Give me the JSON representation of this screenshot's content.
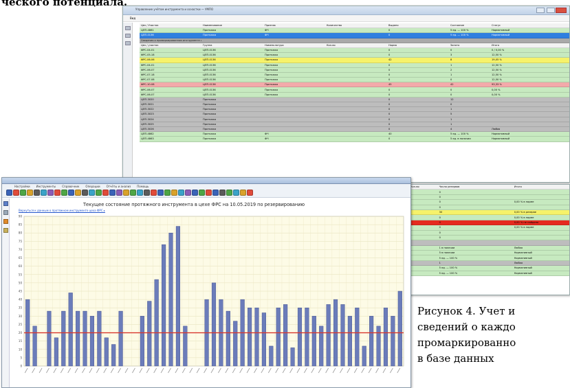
{
  "document": {
    "heading_fragment": "ческого потенциала.",
    "caption_lines": [
      "Рисунок 4. Учет и",
      "сведений о каждо",
      "промаркированно",
      "в базе данных"
    ]
  },
  "back_window": {
    "title": "Управление учётом инструмента и оснастки — УМПО",
    "menu": "Вид",
    "rows": [
      {
        "style": "hdr",
        "cells": [
          "Цех / Участок",
          "Наименование",
          "Признак",
          "Количество",
          "Выдано",
          "Состояние",
          "Статус"
        ]
      },
      {
        "style": "green",
        "cells": [
          "ЦЛП-4861",
          "Протяжка",
          "ФЧ",
          "",
          "0",
          "5 ед. — 100 %",
          "Нормативный"
        ]
      },
      {
        "style": "blue",
        "cells": [
          "ЦЛП-0136",
          "Протяжка",
          "ФЧ",
          "",
          "0",
          "5 ед. — 100 %",
          "Нормативный"
        ]
      },
      {
        "style": "band",
        "cells": [
          "Сведения о промаркированном инструменте цеха",
          "",
          "",
          "",
          "",
          "",
          ""
        ]
      },
      {
        "style": "hdr",
        "cells": [
          "Цех / участок",
          "Группа",
          "Номенклатура",
          "Кол-во",
          "Норма",
          "Занято",
          "Итого"
        ]
      },
      {
        "style": "green",
        "cells": [
          "ФРС-04-01",
          "ЦЛП-0136",
          "Протяжка",
          "",
          "0",
          "0",
          "0 / 0,00 %"
        ]
      },
      {
        "style": "green",
        "cells": [
          "ФРС-05-18",
          "ЦЛП-0136",
          "Протяжка",
          "",
          "0",
          "3",
          "12,50 %"
        ]
      },
      {
        "style": "yellow",
        "cells": [
          "ФРС-06-06",
          "ЦЛП-0136",
          "Протяжка",
          "",
          "42",
          "8",
          "19,05 %"
        ]
      },
      {
        "style": "green",
        "cells": [
          "ФРС-04-01",
          "ЦЛП-0136",
          "Протяжка",
          "",
          "0",
          "1",
          "12,50 %"
        ]
      },
      {
        "style": "green",
        "cells": [
          "ФРС-06-07",
          "ЦЛП-0136",
          "Протяжка",
          "",
          "0",
          "2",
          "12,50 %"
        ]
      },
      {
        "style": "green",
        "cells": [
          "ФРС-07-18",
          "ЦЛП-0136",
          "Протяжка",
          "",
          "0",
          "1",
          "12,50 %"
        ]
      },
      {
        "style": "green",
        "cells": [
          "ФРС-07-08",
          "ЦЛП-0136",
          "Протяжка",
          "",
          "0",
          "0",
          "12,50 %"
        ]
      },
      {
        "style": "pink",
        "cells": [
          "ФРС-10-08",
          "ЦЛП-0136",
          "Протяжка",
          "",
          "45",
          "42",
          "93,33 %"
        ]
      },
      {
        "style": "green",
        "cells": [
          "ФРС-06-07",
          "ЦЛП-0136",
          "Протяжка",
          "",
          "0",
          "0",
          "0,00 %"
        ]
      },
      {
        "style": "green",
        "cells": [
          "ФРС-06-07",
          "ЦЛП-0136",
          "Протяжка",
          "",
          "0",
          "0",
          "0,00 %"
        ]
      },
      {
        "style": "gray",
        "cells": [
          "ЦЛП-3020",
          "Протяжка",
          "",
          "",
          "0",
          "12",
          ""
        ]
      },
      {
        "style": "gray",
        "cells": [
          "ЦЛП-3021",
          "Протяжка",
          "",
          "",
          "0",
          "0",
          ""
        ]
      },
      {
        "style": "gray",
        "cells": [
          "ЦЛП-3022",
          "Протяжка",
          "",
          "",
          "0",
          "1",
          ""
        ]
      },
      {
        "style": "gray",
        "cells": [
          "ЦЛП-3023",
          "Протяжка",
          "",
          "",
          "0",
          "5",
          ""
        ]
      },
      {
        "style": "gray",
        "cells": [
          "ЦЛП-3024",
          "Протяжка",
          "",
          "",
          "0",
          "1",
          ""
        ]
      },
      {
        "style": "gray",
        "cells": [
          "ЦЛП-3025",
          "Протяжка",
          "",
          "",
          "0",
          "1",
          ""
        ]
      },
      {
        "style": "gray",
        "cells": [
          "ЦЛП-3026",
          "Протяжка",
          "",
          "",
          "0",
          "4",
          "Любая"
        ]
      },
      {
        "style": "green",
        "cells": [
          "ЦЛП-4862",
          "Протяжка",
          "ФЧ",
          "",
          "40",
          "5 ед. — 100 %",
          "Нормативный"
        ]
      },
      {
        "style": "green",
        "cells": [
          "ЦЛП-4863",
          "Протяжка",
          "ФЧ",
          "",
          "0",
          "5 ед. в наличии",
          "Нормативный"
        ]
      }
    ]
  },
  "right_window": {
    "rows": [
      {
        "style": "hdr",
        "cells": [
          "Кол-во",
          "Число резервов",
          "Итого"
        ]
      },
      {
        "style": "green",
        "cells": [
          "",
          "0",
          ""
        ]
      },
      {
        "style": "green",
        "cells": [
          "",
          "0",
          ""
        ]
      },
      {
        "style": "green",
        "cells": [
          "",
          "0",
          "0,00 % в норме"
        ]
      },
      {
        "style": "green",
        "cells": [
          "",
          "0",
          ""
        ]
      },
      {
        "style": "yellow",
        "cells": [
          "",
          "30",
          "0,00 % в резерве"
        ]
      },
      {
        "style": "green",
        "cells": [
          "",
          "0",
          "0,00 % в норме"
        ]
      },
      {
        "style": "red",
        "cells": [
          "",
          "0",
          "0,00 % не найдено"
        ]
      },
      {
        "style": "green",
        "cells": [
          "",
          "0",
          "0,00 % в норме"
        ]
      },
      {
        "style": "green",
        "cells": [
          "",
          "0",
          ""
        ]
      },
      {
        "style": "green",
        "cells": [
          "",
          "0",
          ""
        ]
      },
      {
        "style": "gray",
        "cells": [
          "",
          "",
          ""
        ]
      },
      {
        "style": "green",
        "cells": [
          "",
          "1 в наличии",
          "Любая"
        ]
      },
      {
        "style": "green",
        "cells": [
          "",
          "5 в наличии",
          "Нормативный"
        ]
      },
      {
        "style": "green",
        "cells": [
          "",
          "5 ед. — 100 %",
          "Нормативный"
        ]
      },
      {
        "style": "gray",
        "cells": [
          "",
          "1",
          "Любая"
        ]
      },
      {
        "style": "green",
        "cells": [
          "",
          "5 ед. — 100 %",
          "Нормативный"
        ]
      },
      {
        "style": "green",
        "cells": [
          "",
          "5 ед. — 100 %",
          "Нормативный"
        ]
      }
    ]
  },
  "chart_window": {
    "menu_items": [
      "Настройки",
      "Инструменты",
      "Справочник",
      "Операции",
      "Отчёты и анализ",
      "Помощь"
    ],
    "title": "Текущее состояние протяжного инструмента в цехе ФРС на 10.05.2019 по резервированию",
    "link": "Вернуться к данным о протяжном инструменте цеха ФРС ▸"
  },
  "colors": {
    "bar": "#6b7cba",
    "reference_line": "#d8372e",
    "plot_bg": "#fdfbe6"
  },
  "chart_data": {
    "type": "bar",
    "ylim": [
      0,
      90
    ],
    "yticks": [
      0,
      5,
      10,
      15,
      20,
      25,
      30,
      35,
      40,
      45,
      50,
      55,
      60,
      65,
      70,
      75,
      80,
      85,
      90
    ],
    "reference_line": 20,
    "values": [
      40,
      24,
      0,
      33,
      17,
      33,
      44,
      33,
      33,
      30,
      33,
      17,
      13,
      33,
      0,
      0,
      30,
      39,
      52,
      73,
      80,
      84,
      24,
      0,
      0,
      40,
      50,
      40,
      33,
      27,
      40,
      35,
      35,
      32,
      12,
      35,
      37,
      11,
      35,
      35,
      30,
      24,
      37,
      40,
      37,
      30,
      35,
      12,
      30,
      24,
      35,
      30,
      45
    ]
  }
}
